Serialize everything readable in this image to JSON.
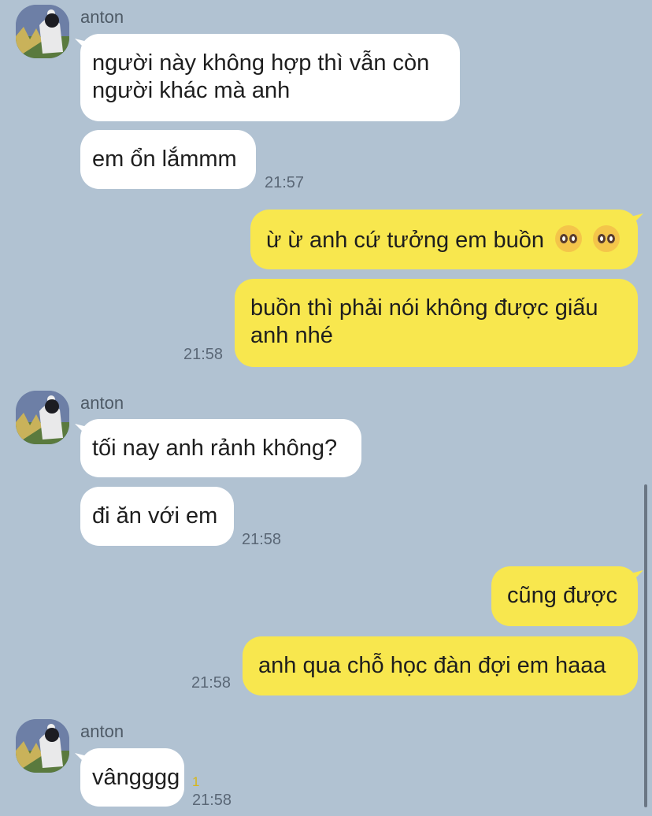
{
  "contact": {
    "name": "anton",
    "avatar_icon": "profile-photo-icon"
  },
  "messages": [
    {
      "text_lines": [
        "người này không hợp thì vẫn còn",
        "người khác mà anh"
      ]
    },
    {
      "text": "em ổn lắmmm",
      "time": "21:57"
    },
    {
      "text": "ừ ừ anh cứ tưởng em buồn",
      "emoji": [
        "pleading-face-emoji",
        "pleading-face-emoji"
      ]
    },
    {
      "text_lines": [
        "buồn thì phải nói không được giấu",
        "anh nhé"
      ],
      "time": "21:58"
    },
    {
      "text": "tối nay anh rảnh không?"
    },
    {
      "text": "đi ăn với em",
      "time": "21:58"
    },
    {
      "text": "cũng được"
    },
    {
      "text": "anh qua chỗ học đàn đợi em haaa",
      "time": "21:58"
    },
    {
      "text": "vângggg",
      "unread": "1",
      "time": "21:58"
    }
  ],
  "colors": {
    "background": "#b1c2d2",
    "incoming": "#ffffff",
    "outgoing": "#f8e74e"
  }
}
